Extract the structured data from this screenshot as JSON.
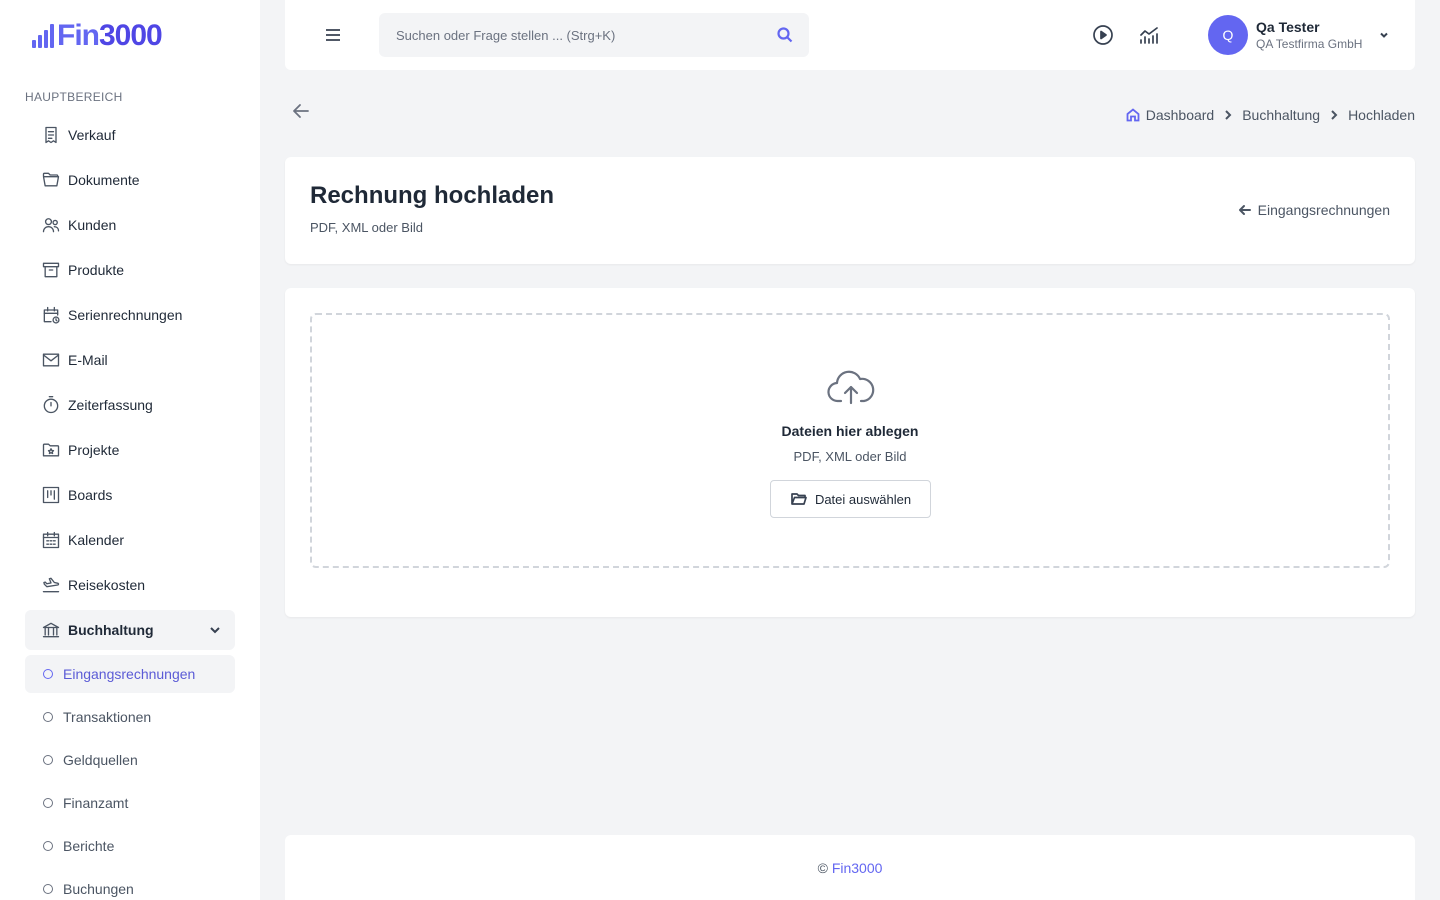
{
  "brand": {
    "name_prefix": "Fin",
    "name_suffix": "3000",
    "accent": "#6366f1"
  },
  "sidebar": {
    "section_label": "HAUPTBEREICH",
    "items": [
      {
        "label": "Verkauf",
        "icon": "receipt-icon"
      },
      {
        "label": "Dokumente",
        "icon": "folder-icon"
      },
      {
        "label": "Kunden",
        "icon": "users-icon"
      },
      {
        "label": "Produkte",
        "icon": "archive-box-icon"
      },
      {
        "label": "Serienrechnungen",
        "icon": "calendar-clock-icon"
      },
      {
        "label": "E-Mail",
        "icon": "envelope-icon"
      },
      {
        "label": "Zeiterfassung",
        "icon": "stopwatch-icon"
      },
      {
        "label": "Projekte",
        "icon": "folder-star-icon"
      },
      {
        "label": "Boards",
        "icon": "kanban-icon"
      },
      {
        "label": "Kalender",
        "icon": "calendar-icon"
      },
      {
        "label": "Reisekosten",
        "icon": "plane-icon"
      },
      {
        "label": "Buchhaltung",
        "icon": "bank-icon"
      }
    ],
    "submenu": [
      {
        "label": "Eingangsrechnungen",
        "active": true
      },
      {
        "label": "Transaktionen"
      },
      {
        "label": "Geldquellen"
      },
      {
        "label": "Finanzamt"
      },
      {
        "label": "Berichte"
      },
      {
        "label": "Buchungen"
      }
    ]
  },
  "topbar": {
    "search_placeholder": "Suchen oder Frage stellen ... (Strg+K)",
    "user": {
      "initial": "Q",
      "name": "Qa Tester",
      "company": "QA Testfirma GmbH"
    }
  },
  "breadcrumb": {
    "items": [
      "Dashboard",
      "Buchhaltung",
      "Hochladen"
    ]
  },
  "header": {
    "title": "Rechnung hochladen",
    "subtitle": "PDF, XML oder Bild",
    "back_link": "Eingangsrechnungen"
  },
  "upload": {
    "title": "Dateien hier ablegen",
    "subtitle": "PDF, XML oder Bild",
    "button": "Datei auswählen"
  },
  "footer": {
    "copyright": "©",
    "link": "Fin3000"
  }
}
